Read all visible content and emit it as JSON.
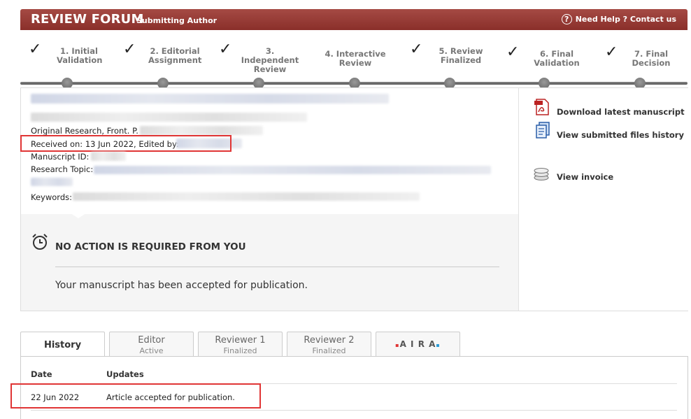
{
  "header": {
    "brand": "REVIEW FORUM",
    "role": "Submitting Author",
    "help": "Need Help ? Contact us"
  },
  "steps": [
    {
      "label": "1. Initial\nValidation",
      "done": true
    },
    {
      "label": "2. Editorial\nAssignment",
      "done": true
    },
    {
      "label": "3. Independent\nReview",
      "done": true
    },
    {
      "label": "4. Interactive Review",
      "done": false
    },
    {
      "label": "5. Review\nFinalized",
      "done": true
    },
    {
      "label": "6. Final Validation",
      "done": true
    },
    {
      "label": "7. Final Decision",
      "done": true
    }
  ],
  "manuscript": {
    "type_label": "Original Research, Front. P.",
    "received_label": "Received on:",
    "received_date": "13 Jun 2022",
    "edited_label": ", Edited by:",
    "manuscript_id_label": "Manuscript ID:",
    "research_topic_label": "Research Topic:",
    "keywords_label": "Keywords:"
  },
  "status": {
    "heading": "NO ACTION IS REQUIRED FROM YOU",
    "message": "Your manuscript has been accepted for publication."
  },
  "side_links": {
    "download": "Download latest manuscript",
    "files_history": "View submitted files history",
    "invoice": "View invoice"
  },
  "tabs": [
    {
      "label": "History",
      "sub": ""
    },
    {
      "label": "Editor",
      "sub": "Active"
    },
    {
      "label": "Reviewer 1",
      "sub": "Finalized"
    },
    {
      "label": "Reviewer 2",
      "sub": "Finalized"
    },
    {
      "label": "A I R A",
      "sub": ""
    }
  ],
  "history": {
    "col_date": "Date",
    "col_updates": "Updates",
    "rows": [
      {
        "date": "22 Jun 2022",
        "update": "Article accepted for publication."
      }
    ]
  },
  "colors": {
    "header": "#8a2f2a",
    "highlight": "#e03535"
  }
}
